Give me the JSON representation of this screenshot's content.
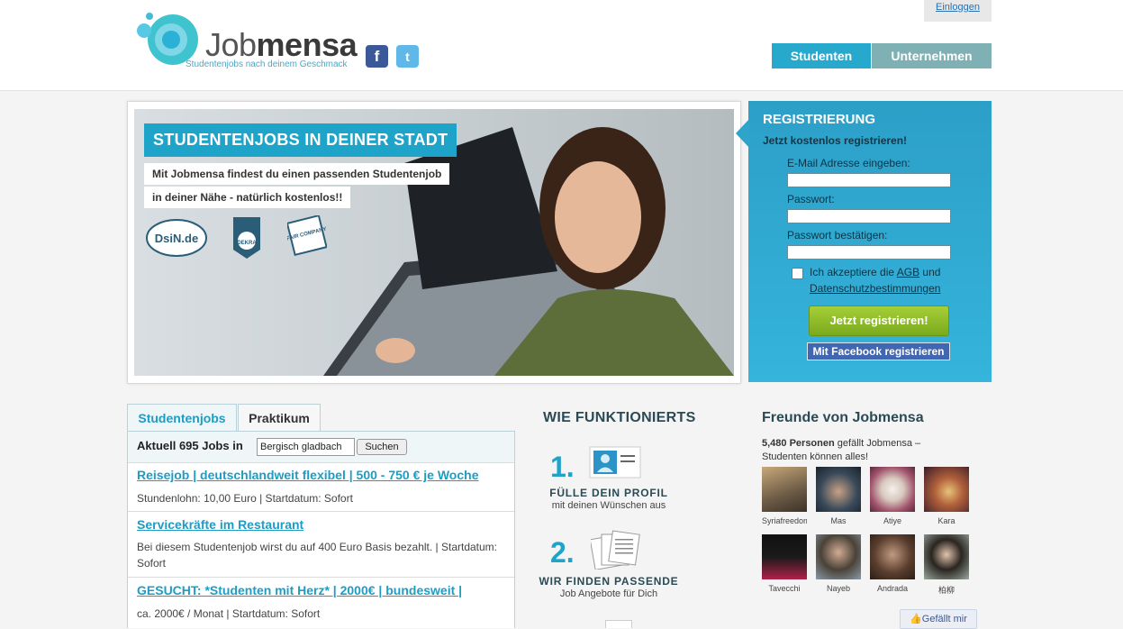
{
  "header": {
    "brand_light": "Job",
    "brand_bold": "mensa",
    "tagline": "Studentenjobs nach deinem Geschmack",
    "facebook_glyph": "f",
    "twitter_glyph": "t",
    "login_label": "Einloggen",
    "nav": {
      "students": "Studenten",
      "companies": "Unternehmen"
    }
  },
  "hero": {
    "headline": "STUDENTENJOBS IN DEINER STADT",
    "line1": "Mit Jobmensa findest du einen passenden Studentenjob",
    "line2": "in deiner Nähe - natürlich kostenlos!!",
    "badges": [
      "DsiN.de",
      "DEKRA",
      "FAIR COMPANY"
    ]
  },
  "registration": {
    "title": "REGISTRIERUNG",
    "subtitle": "Jetzt kostenlos registrieren!",
    "email_label": "E-Mail Adresse eingeben:",
    "password_label": "Passwort:",
    "password_confirm_label": "Passwort bestätigen:",
    "agree_prefix": "Ich akzeptiere die",
    "agree_link1": "AGB",
    "agree_mid": "und",
    "agree_link2": "Datenschutzbestimmungen",
    "submit_label": "Jetzt registrieren!",
    "facebook_label": "Mit Facebook registrieren"
  },
  "jobs": {
    "tabs": [
      "Studentenjobs",
      "Praktikum"
    ],
    "count_label": "Aktuell 695 Jobs in",
    "city_value": "Bergisch gladbach",
    "search_label": "Suchen",
    "items": [
      {
        "title": "Reisejob | deutschlandweit flexibel | 500 - 750 € je Woche",
        "desc": "Stundenlohn: 10,00 Euro | Startdatum: Sofort"
      },
      {
        "title": "Servicekräfte im Restaurant",
        "desc": "Bei diesem Studentenjob wirst du auf 400 Euro Basis bezahlt. | Startdatum: Sofort"
      },
      {
        "title": "GESUCHT: *Studenten mit Herz* | 2000€ | bundesweit |",
        "desc": "ca. 2000€ / Monat | Startdatum: Sofort"
      }
    ]
  },
  "how": {
    "title": "WIE FUNKTIONIERTS",
    "steps": [
      {
        "num": "1.",
        "head": "FÜLLE DEIN PROFIL",
        "sub": "mit deinen Wünschen aus"
      },
      {
        "num": "2.",
        "head": "WIR FINDEN PASSENDE",
        "sub": "Job Angebote für Dich"
      }
    ]
  },
  "friends": {
    "title": "Freunde von Jobmensa",
    "count_bold": "5,480 Personen",
    "count_rest": "gefällt Jobmensa – Studenten können alles!",
    "people": [
      "Syriafreedom",
      "Mas",
      "Atiye",
      "Kara",
      "Tavecchi",
      "Nayeb",
      "Andrada",
      "柏柳"
    ],
    "like_label": "Gefällt mir"
  },
  "colors": {
    "accent": "#1ea3c9",
    "reg_bg": "#2ea4cc",
    "green": "#8dbd2a",
    "nav_gray": "#7fb0b3"
  }
}
